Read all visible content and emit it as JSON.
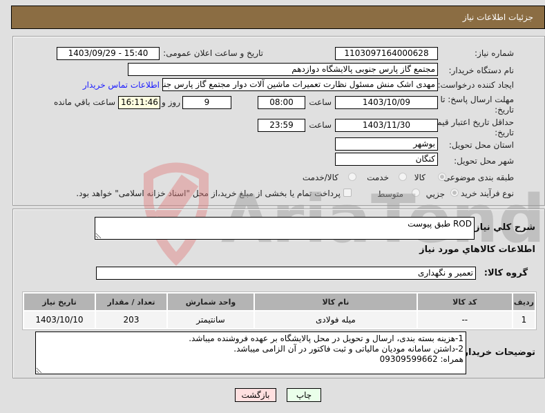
{
  "header": {
    "title": "جزئیات اطلاعات نیاز"
  },
  "form": {
    "need_number": {
      "label": "شماره نیاز:",
      "value": "1103097164000628"
    },
    "announce_datetime": {
      "label": "تاریخ و ساعت اعلان عمومی:",
      "value": "1403/09/29 - 15:40"
    },
    "buyer_org": {
      "label": "نام دستگاه خریدار:",
      "value": "مجتمع گاز پارس جنوبی  پالایشگاه دوازدهم"
    },
    "requester": {
      "label": "ایجاد کننده درخواست:",
      "value": "مهدی اشک منش مسئول نظارت تعمیرات ماشین آلات دوار مجتمع گاز پارس جنوبی",
      "contact_link": "اطلاعات تماس خریدار"
    },
    "response_deadline": {
      "label_line1": "مهلت ارسال پاسخ: تا",
      "label_line2": "تاریخ:",
      "date": "1403/10/09",
      "time_label": "ساعت",
      "time": "08:00",
      "days": "9",
      "days_label": "روز و",
      "remaining_time": "16:11:46",
      "remaining_label": "ساعت باقي مانده"
    },
    "price_validity": {
      "label_line1": "حداقل تاریخ اعتبار قیمت: تا",
      "label_line2": "تاریخ:",
      "date": "1403/11/30",
      "time_label": "ساعت",
      "time": "23:59"
    },
    "delivery_province": {
      "label": "استان محل تحویل:",
      "value": "بوشهر"
    },
    "delivery_city": {
      "label": "شهر محل تحویل:",
      "value": "کنگان"
    },
    "category": {
      "label": "طبقه بندی موضوعی:",
      "options": [
        "کالا",
        "خدمت",
        "کالا/خدمت"
      ],
      "selected": "کالا"
    },
    "purchase_type": {
      "label": "نوع فرآیند خرید :",
      "options": [
        "جزیي",
        "متوسط"
      ],
      "selected": "جزیي",
      "treasury_note": "پرداخت تمام یا بخشی از مبلغ خرید،از محل \"اسناد خزانه اسلامی\" خواهد بود."
    }
  },
  "details": {
    "description": {
      "label": "شرح کلي نياز:",
      "value": "ROD طبق پیوست"
    },
    "items_title": "اطلاعات کالاهاي مورد نياز",
    "goods_group": {
      "label": "گروه کالا:",
      "value": "تعمیر و نگهداری"
    },
    "table": {
      "columns": [
        "ردیف",
        "کد کالا",
        "نام کالا",
        "واحد شمارش",
        "تعداد / مقدار",
        "تاریخ نیاز"
      ],
      "rows": [
        [
          "1",
          "--",
          "میله فولادی",
          "سانتیمتر",
          "203",
          "1403/10/10"
        ]
      ]
    },
    "buyer_notes": {
      "label": "توضیحات خریدار:",
      "value": "1-هزینه بسته بندی، ارسال و تحویل در محل پالایشگاه بر عهده فروشنده میباشد.\n2-داشتن سامانه مودیان مالیاتی و ثبت فاکتور در آن الزامی میباشد.\nهمراه: 09309599662"
    }
  },
  "buttons": {
    "print": "چاپ",
    "back": "بازگشت"
  },
  "watermark": {
    "text": "AriaTender.neT"
  },
  "colors": {
    "header_bg": "#8b6d43",
    "print_bg": "#eaffea",
    "back_bg": "#ffe0e0",
    "link": "#1a1aff"
  }
}
